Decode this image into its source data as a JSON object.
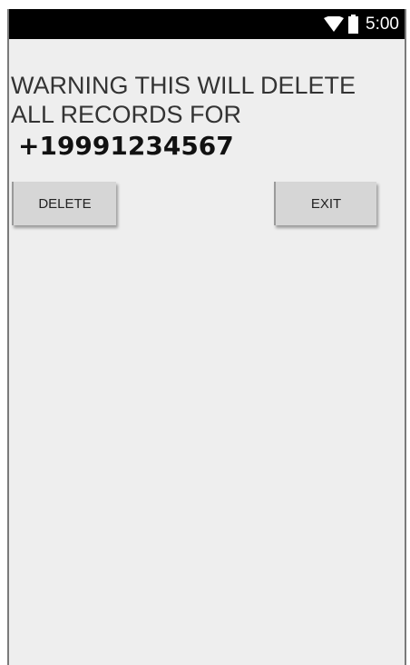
{
  "status_bar": {
    "time": "5:00",
    "wifi_icon": "wifi-icon",
    "battery_icon": "battery-icon"
  },
  "content": {
    "warning_line1": "WARNING THIS WILL DELETE",
    "warning_line2": "ALL RECORDS FOR",
    "phone_number": "+19991234567"
  },
  "buttons": {
    "delete_label": "DELETE",
    "exit_label": "EXIT"
  },
  "colors": {
    "background": "#eeeeee",
    "status_bar": "#000000",
    "button": "#d6d6d6"
  }
}
